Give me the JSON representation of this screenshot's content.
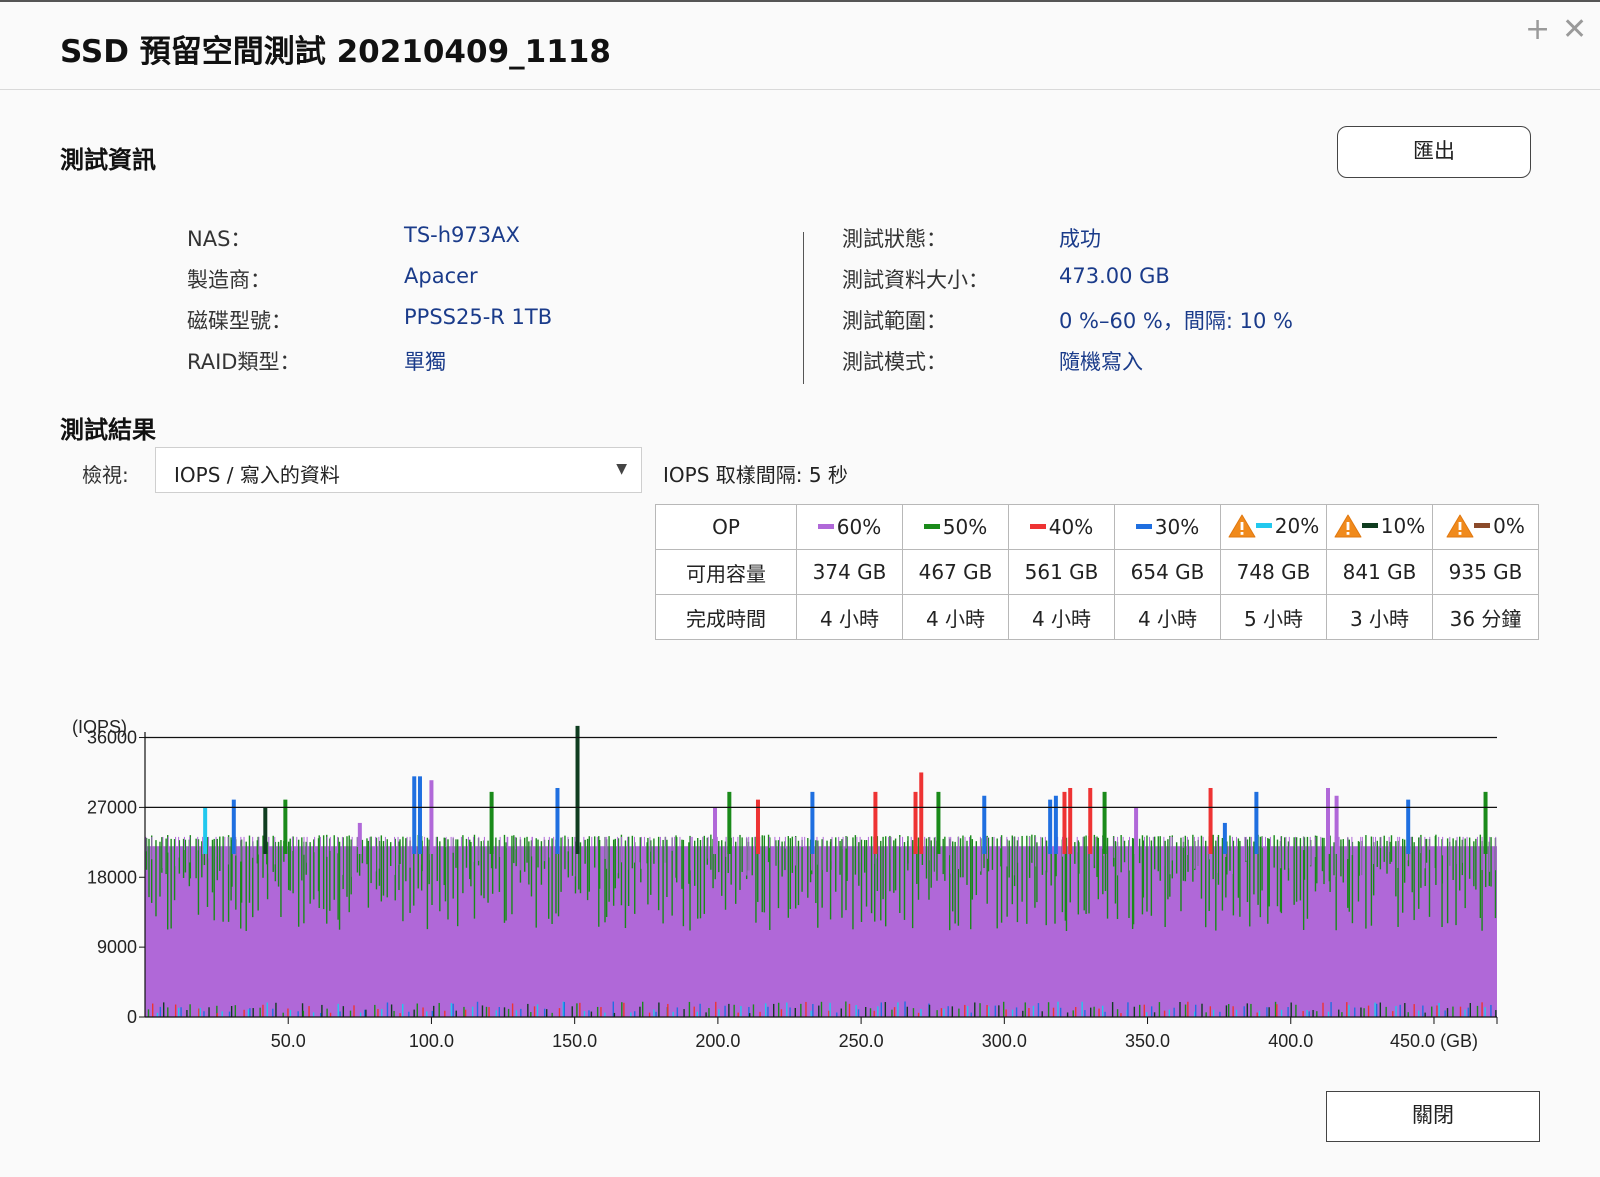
{
  "window": {
    "title": "SSD 預留空間測試 20210409_1118",
    "add_label": "+",
    "close_label": "✕"
  },
  "test_info": {
    "heading": "測試資訊",
    "export_label": "匯出",
    "left": [
      {
        "label": "NAS：",
        "value": "TS-h973AX"
      },
      {
        "label": "製造商：",
        "value": "Apacer"
      },
      {
        "label": "磁碟型號：",
        "value": "PPSS25-R 1TB"
      },
      {
        "label": "RAID類型：",
        "value": "單獨"
      }
    ],
    "right": [
      {
        "label": "測試狀態：",
        "value": "成功"
      },
      {
        "label": "測試資料大小：",
        "value": "473.00 GB"
      },
      {
        "label": "測試範圍：",
        "value": "0 %–60 %，間隔: 10 %"
      },
      {
        "label": "測試模式：",
        "value": "隨機寫入"
      }
    ]
  },
  "results": {
    "heading": "測試結果",
    "view_label": "檢視:",
    "view_selected": "IOPS / 寫入的資料",
    "sample_interval": "IOPS 取樣間隔: 5 秒",
    "table": {
      "row_headers": [
        "OP",
        "可用容量",
        "完成時間"
      ],
      "columns": [
        {
          "op": "60%",
          "color": "#b068d8",
          "warn": false,
          "capacity": "374 GB",
          "time": "4 小時"
        },
        {
          "op": "50%",
          "color": "#1a8a1a",
          "warn": false,
          "capacity": "467 GB",
          "time": "4 小時"
        },
        {
          "op": "40%",
          "color": "#ee3333",
          "warn": false,
          "capacity": "561 GB",
          "time": "4 小時"
        },
        {
          "op": "30%",
          "color": "#1f6fe0",
          "warn": false,
          "capacity": "654 GB",
          "time": "4 小時"
        },
        {
          "op": "20%",
          "color": "#22c8ee",
          "warn": true,
          "capacity": "748 GB",
          "time": "5 小時"
        },
        {
          "op": "10%",
          "color": "#0f3d20",
          "warn": true,
          "capacity": "841 GB",
          "time": "3 小時"
        },
        {
          "op": "0%",
          "color": "#8b4a2a",
          "warn": true,
          "capacity": "935 GB",
          "time": "36 分鐘"
        }
      ]
    }
  },
  "chart_data": {
    "type": "bar",
    "ylabel": "(IOPS)",
    "xlabel": "(GB)",
    "ylim": [
      0,
      36000
    ],
    "xlim": [
      0,
      472
    ],
    "y_ticks": [
      "0",
      "9000",
      "18000",
      "27000",
      "36000"
    ],
    "x_ticks": [
      "50.0",
      "100.0",
      "150.0",
      "200.0",
      "250.0",
      "300.0",
      "350.0",
      "400.0",
      "450.0"
    ],
    "grid": true,
    "series": [
      {
        "name": "60%",
        "color": "#b068d8",
        "x": [
          0,
          472
        ],
        "values": [
          22000,
          22000
        ]
      },
      {
        "name": "50%",
        "color": "#1a8a1a",
        "x": [
          0,
          472
        ],
        "values": [
          20000,
          20000
        ]
      }
    ],
    "spikes": [
      {
        "x": 21,
        "value": 27000,
        "color": "#22c8ee"
      },
      {
        "x": 31,
        "value": 28000,
        "color": "#1f6fe0"
      },
      {
        "x": 42,
        "value": 27000,
        "color": "#0f3d20"
      },
      {
        "x": 49,
        "value": 28000,
        "color": "#1a8a1a"
      },
      {
        "x": 75,
        "value": 25000,
        "color": "#b068d8"
      },
      {
        "x": 94,
        "value": 31000,
        "color": "#1f6fe0"
      },
      {
        "x": 96,
        "value": 31000,
        "color": "#1f6fe0"
      },
      {
        "x": 100,
        "value": 30500,
        "color": "#b068d8"
      },
      {
        "x": 121,
        "value": 29000,
        "color": "#1a8a1a"
      },
      {
        "x": 144,
        "value": 29500,
        "color": "#1f6fe0"
      },
      {
        "x": 151,
        "value": 37500,
        "color": "#0f3d20"
      },
      {
        "x": 199,
        "value": 27000,
        "color": "#b068d8"
      },
      {
        "x": 204,
        "value": 29000,
        "color": "#1a8a1a"
      },
      {
        "x": 214,
        "value": 28000,
        "color": "#ee3333"
      },
      {
        "x": 233,
        "value": 29000,
        "color": "#1f6fe0"
      },
      {
        "x": 255,
        "value": 29000,
        "color": "#ee3333"
      },
      {
        "x": 269,
        "value": 29000,
        "color": "#ee3333"
      },
      {
        "x": 271,
        "value": 31500,
        "color": "#ee3333"
      },
      {
        "x": 277,
        "value": 29000,
        "color": "#1a8a1a"
      },
      {
        "x": 293,
        "value": 28500,
        "color": "#1f6fe0"
      },
      {
        "x": 316,
        "value": 28000,
        "color": "#1f6fe0"
      },
      {
        "x": 318,
        "value": 28500,
        "color": "#1f6fe0"
      },
      {
        "x": 321,
        "value": 29000,
        "color": "#ee3333"
      },
      {
        "x": 323,
        "value": 29500,
        "color": "#ee3333"
      },
      {
        "x": 330,
        "value": 29500,
        "color": "#ee3333"
      },
      {
        "x": 335,
        "value": 29000,
        "color": "#1a8a1a"
      },
      {
        "x": 346,
        "value": 27000,
        "color": "#b068d8"
      },
      {
        "x": 372,
        "value": 29500,
        "color": "#ee3333"
      },
      {
        "x": 377,
        "value": 25000,
        "color": "#1f6fe0"
      },
      {
        "x": 388,
        "value": 29000,
        "color": "#1f6fe0"
      },
      {
        "x": 413,
        "value": 29500,
        "color": "#b068d8"
      },
      {
        "x": 416,
        "value": 28500,
        "color": "#b068d8"
      },
      {
        "x": 441,
        "value": 28000,
        "color": "#1f6fe0"
      },
      {
        "x": 468,
        "value": 29000,
        "color": "#1a8a1a"
      }
    ]
  },
  "footer": {
    "close_label": "關閉"
  }
}
